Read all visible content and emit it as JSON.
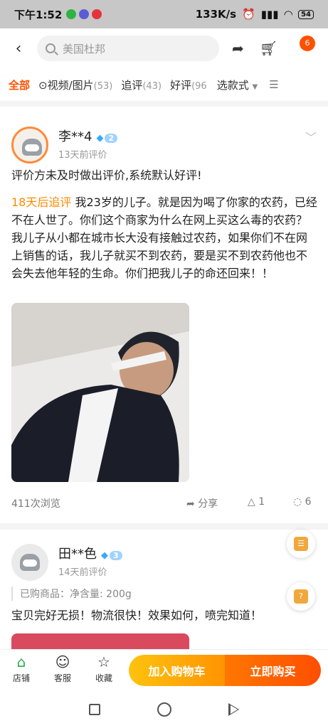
{
  "status": {
    "time": "下午1:52",
    "speed": "133K/s",
    "battery": "54"
  },
  "header": {
    "search_text": "美国杜邦",
    "cart_count": "6"
  },
  "tabs": [
    {
      "label": "全部",
      "count": ""
    },
    {
      "label": "视频/图片",
      "count": "(53)"
    },
    {
      "label": "追评",
      "count": "(43)"
    },
    {
      "label": "好评",
      "count": "(96"
    }
  ],
  "filter_label": "选款式",
  "reviews": [
    {
      "user": "李**4",
      "level": "2",
      "time": "13天前评价",
      "text": "评价方未及时做出评价,系统默认好评!",
      "followup_tag": "18天后追评",
      "followup_text": "我23岁的儿子。就是因为喝了你家的农药，已经不在人世了。你们这个商家为什么在网上买这么毒的农药？ 我儿子从小都在城市长大没有接触过农药，如果你们不在网上销售的话，我儿子就买不到农药，要是买不到农药他也不会失去他年轻的生命。你们把我儿子的命还回来！！",
      "views": "411次浏览",
      "share": "分享",
      "likes": "1",
      "comments": "6"
    },
    {
      "user": "田**色",
      "level": "3",
      "time": "14天前评价",
      "sku": "已购商品：净含量: 200g",
      "text": "宝贝完好无损！物流很快！效果如何，喷完知道！"
    }
  ],
  "actionbar": {
    "shop": "店铺",
    "service": "客服",
    "favorite": "收藏",
    "add_to_cart": "加入购物车",
    "buy_now": "立即购买"
  },
  "colors": {
    "accent": "#ff5000",
    "followup": "#ff8a00"
  },
  "icons": [
    "back-icon",
    "search-icon",
    "share-icon",
    "cart-icon",
    "play-icon",
    "grid-icon",
    "chevron-down-icon",
    "shop-icon",
    "service-icon",
    "star-icon"
  ]
}
